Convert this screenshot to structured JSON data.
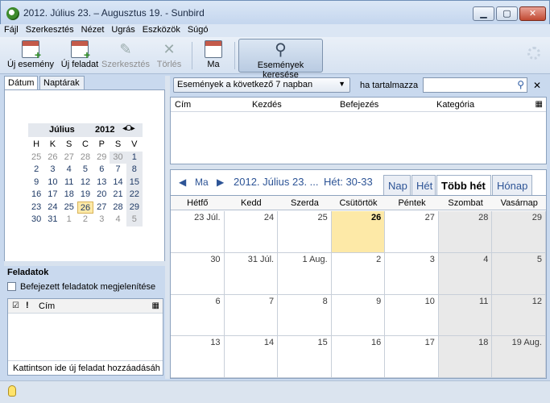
{
  "window": {
    "title": "2012. Július 23. – Augusztus 19. - Sunbird",
    "min": "▁",
    "max": "▢",
    "close": "✕"
  },
  "menu": [
    "Fájl",
    "Szerkesztés",
    "Nézet",
    "Ugrás",
    "Eszközök",
    "Súgó"
  ],
  "toolbar": {
    "new_event": "Új esemény",
    "new_task": "Új feladat",
    "edit": "Szerkesztés",
    "delete": "Törlés",
    "today": "Ma",
    "find_events": "Események keresése"
  },
  "left_tabs": {
    "date": "Dátum",
    "calendars": "Naptárak"
  },
  "minical": {
    "month": "Július",
    "year": "2012",
    "nav": "◂O▸",
    "weekdays": [
      "H",
      "K",
      "S",
      "C",
      "P",
      "S",
      "V"
    ],
    "weeks": [
      [
        "25",
        "26",
        "27",
        "28",
        "29",
        "30",
        "1"
      ],
      [
        "2",
        "3",
        "4",
        "5",
        "6",
        "7",
        "8"
      ],
      [
        "9",
        "10",
        "11",
        "12",
        "13",
        "14",
        "15"
      ],
      [
        "16",
        "17",
        "18",
        "19",
        "20",
        "21",
        "22"
      ],
      [
        "23",
        "24",
        "25",
        "26",
        "27",
        "28",
        "29"
      ],
      [
        "30",
        "31",
        "1",
        "2",
        "3",
        "4",
        "5"
      ]
    ]
  },
  "tasks": {
    "title": "Feladatok",
    "show_completed": "Befejezett feladatok megjelenítése",
    "col_title": "Cím",
    "add_hint": "Kattintson ide új feladat hozzáadásáh"
  },
  "search": {
    "filter": "Események a következő 7 napban",
    "contains_label": "ha tartalmazza",
    "value": ""
  },
  "events_columns": [
    "Cím",
    "Kezdés",
    "Befejezés",
    "Kategória"
  ],
  "view": {
    "today": "Ma",
    "title": "2012. Július 23. ...",
    "week": "Hét: 30-33",
    "tabs": [
      "Nap",
      "Hét",
      "Több hét",
      "Hónap"
    ],
    "active_tab": "Több hét"
  },
  "grid": {
    "days": [
      "Hétfő",
      "Kedd",
      "Szerda",
      "Csütörtök",
      "Péntek",
      "Szombat",
      "Vasárnap"
    ],
    "weeks": [
      [
        "23 Júl.",
        "24",
        "25",
        "26",
        "27",
        "28",
        "29"
      ],
      [
        "30",
        "31 Júl.",
        "1 Aug.",
        "2",
        "3",
        "4",
        "5"
      ],
      [
        "6",
        "7",
        "8",
        "9",
        "10",
        "11",
        "12"
      ],
      [
        "13",
        "14",
        "15",
        "16",
        "17",
        "18",
        "19 Aug."
      ]
    ]
  }
}
